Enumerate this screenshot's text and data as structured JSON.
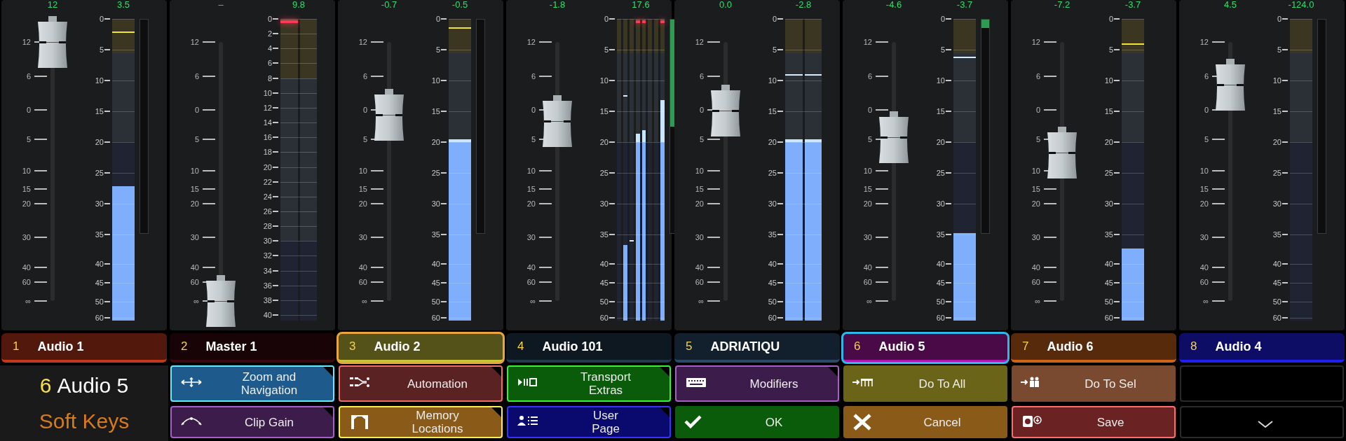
{
  "strips": [
    {
      "number": "1",
      "name": "Audio 1",
      "color": "#c0391b",
      "selected": false,
      "highlighted": false,
      "gain": "12",
      "peak": "3.5",
      "fader": {
        "level": 1.0
      },
      "fader_scale": [
        "12",
        "6",
        "0",
        "5",
        "10",
        "15",
        "20",
        "30",
        "40",
        "60",
        "∞"
      ],
      "meter_scale": [
        "0",
        "5",
        "10",
        "15",
        "20",
        "25",
        "30",
        "35",
        "40",
        "45",
        "50",
        "60"
      ],
      "meter": [
        {
          "level": 0.445,
          "hold": {
            "level": 0.958
          },
          "clip": false
        }
      ],
      "reduction": {
        "level": 0
      }
    },
    {
      "number": "2",
      "name": "Master 1",
      "color": "#3a0a10",
      "selected": false,
      "highlighted": false,
      "gain": "–",
      "peak": "9.8",
      "fader": {
        "level": 0
      },
      "fader_scale": [
        "12",
        "6",
        "0",
        "5",
        "10",
        "15",
        "20",
        "30",
        "40",
        "60",
        "∞"
      ],
      "meter_scale": [
        "0",
        "2",
        "4",
        "6",
        "8",
        "10",
        "12",
        "14",
        "16",
        "18",
        "20",
        "22",
        "24",
        "26",
        "28",
        "30",
        "32",
        "34",
        "36",
        "38",
        "40"
      ],
      "meter": [
        {
          "level": 0,
          "clip": true
        },
        {
          "level": 0,
          "clip": false
        }
      ]
    },
    {
      "number": "3",
      "name": "Audio 2",
      "color": "#c8c43c",
      "selected": false,
      "highlighted": true,
      "gain": "-0.7",
      "peak": "-0.5",
      "fader": {
        "level": 0.719
      },
      "fader_scale": [
        "12",
        "6",
        "0",
        "5",
        "10",
        "15",
        "20",
        "30",
        "40",
        "60",
        "∞"
      ],
      "meter_scale": [
        "0",
        "5",
        "10",
        "15",
        "20",
        "25",
        "30",
        "35",
        "40",
        "45",
        "50",
        "60"
      ],
      "meter": [
        {
          "level": 0.6,
          "hold": {
            "level": 0.972
          },
          "clip": false
        }
      ],
      "reduction": {
        "level": 0
      }
    },
    {
      "number": "4",
      "name": "Audio 101",
      "color": "#22394f",
      "selected": false,
      "highlighted": false,
      "gain": "-1.8",
      "peak": "17.6",
      "fader": {
        "level": 0.695
      },
      "fader_scale": [
        "12",
        "6",
        "0",
        "5",
        "10",
        "15",
        "20",
        "30",
        "40",
        "60",
        "∞"
      ],
      "meter_scale": [
        "0",
        "5",
        "10",
        "15",
        "20",
        "25",
        "30",
        "35",
        "40",
        "45",
        "50",
        "60"
      ],
      "meter": [
        {
          "level": 0,
          "clip": false
        },
        {
          "level": 0.25,
          "hold": {
            "level": 0.747
          },
          "clip": false
        },
        {
          "level": 0,
          "hold": {
            "level": 0.267
          },
          "clip": false
        },
        {
          "level": 0.62,
          "clip": true
        },
        {
          "level": 0.63,
          "clip": true
        },
        {
          "level": 0,
          "clip": false
        },
        {
          "level": 0,
          "clip": false
        },
        {
          "level": 0.73,
          "clip": true
        }
      ],
      "reduction": {
        "level": 0.5
      }
    },
    {
      "number": "5",
      "name": "ADRIATIQU",
      "color": "#2a4a68",
      "selected": false,
      "highlighted": false,
      "gain": "0.0",
      "peak": "-2.8",
      "fader": {
        "level": 0.735
      },
      "fader_scale": [
        "12",
        "6",
        "0",
        "5",
        "10",
        "15",
        "20",
        "30",
        "40",
        "60",
        "∞"
      ],
      "meter_scale": [
        "0",
        "5",
        "10",
        "15",
        "20",
        "25",
        "30",
        "35",
        "40",
        "45",
        "50",
        "60"
      ],
      "meter": [
        {
          "level": 0.6,
          "hold": {
            "level": 0.817
          },
          "clip": false
        },
        {
          "level": 0.6,
          "hold": {
            "level": 0.817
          },
          "clip": false
        }
      ]
    },
    {
      "number": "6",
      "name": "Audio 5",
      "color": "#b018ac",
      "selected": true,
      "highlighted": false,
      "gain": "-4.6",
      "peak": "-3.7",
      "fader": {
        "level": 0.632
      },
      "fader_scale": [
        "12",
        "6",
        "0",
        "5",
        "10",
        "15",
        "20",
        "30",
        "40",
        "60",
        "∞"
      ],
      "meter_scale": [
        "0",
        "5",
        "10",
        "15",
        "20",
        "25",
        "30",
        "35",
        "40",
        "45",
        "50",
        "60"
      ],
      "meter": [
        {
          "level": 0.29,
          "hold": {
            "level": 0.875
          },
          "clip": false
        }
      ],
      "reduction": {
        "level": 0.04
      }
    },
    {
      "number": "7",
      "name": "Audio 6",
      "color": "#d0641a",
      "selected": false,
      "highlighted": false,
      "gain": "-7.2",
      "peak": "-3.7",
      "fader": {
        "level": 0.573
      },
      "fader_scale": [
        "12",
        "6",
        "0",
        "5",
        "10",
        "15",
        "20",
        "30",
        "40",
        "60",
        "∞"
      ],
      "meter_scale": [
        "0",
        "5",
        "10",
        "15",
        "20",
        "25",
        "30",
        "35",
        "40",
        "45",
        "50",
        "60"
      ],
      "meter": [
        {
          "level": 0.24,
          "hold": {
            "level": 0.919
          },
          "clip": false
        }
      ]
    },
    {
      "number": "8",
      "name": "Audio 4",
      "color": "#2020f0",
      "selected": false,
      "highlighted": false,
      "gain": "4.5",
      "peak": "-124.0",
      "fader": {
        "level": 0.835
      },
      "fader_scale": [
        "12",
        "6",
        "0",
        "5",
        "10",
        "15",
        "20",
        "30",
        "40",
        "60",
        "∞"
      ],
      "meter_scale": [
        "0",
        "5",
        "10",
        "15",
        "20",
        "25",
        "30",
        "35",
        "40",
        "45",
        "50",
        "60"
      ],
      "meter": [
        {
          "level": 0,
          "clip": false
        }
      ],
      "reduction": {
        "level": 0
      }
    }
  ],
  "panel": {
    "number": "6",
    "name": "Audio 5",
    "title": "Soft Keys"
  },
  "buttons": [
    {
      "kind": "menu",
      "label": "Zoom and\nNavigation",
      "color": "#1f5a8c"
    },
    {
      "kind": "menu",
      "label": "Automation",
      "color": "#5a2222"
    },
    {
      "kind": "menu",
      "label": "Transport\nExtras",
      "color": "#0a5c0a"
    },
    {
      "kind": "menu",
      "label": "Modifiers",
      "color": "#3c1c4a"
    },
    {
      "kind": "action",
      "label": "Do To All",
      "color": "#6a6418"
    },
    {
      "kind": "action",
      "label": "Do To Sel",
      "color": "#7a4a30"
    },
    {
      "kind": "empty",
      "color": "#000000"
    },
    {
      "kind": "menu",
      "label": "Clip Gain",
      "color": "#3c1c4a"
    },
    {
      "kind": "menu",
      "label": "Memory\nLocations",
      "color": "#8a5a18"
    },
    {
      "kind": "menu",
      "label": "User\nPage",
      "color": "#0a0a6e"
    },
    {
      "kind": "action",
      "label": "OK",
      "color": "#0a5c0a"
    },
    {
      "kind": "action",
      "label": "Cancel",
      "color": "#8a5a18"
    },
    {
      "kind": "framed",
      "label": "Save",
      "color": "#6a2222"
    },
    {
      "kind": "more",
      "color": "#000000"
    }
  ]
}
